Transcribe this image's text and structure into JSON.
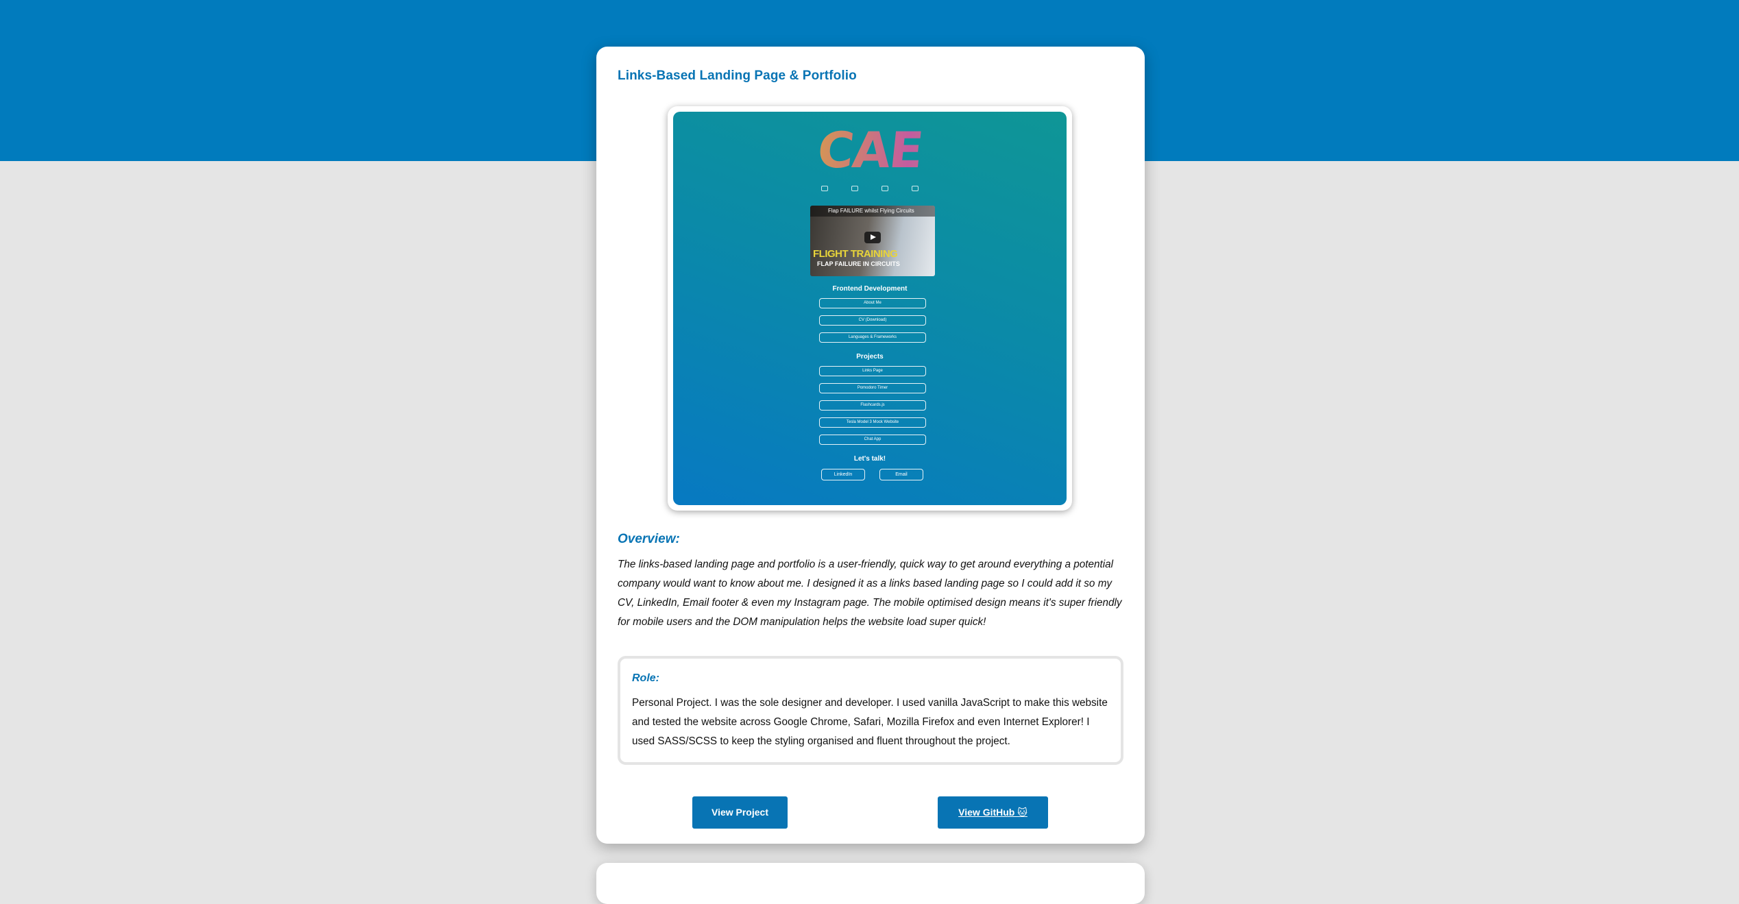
{
  "project": {
    "title": "Links-Based Landing Page & Portfolio",
    "overview_heading": "Overview:",
    "overview_text": "The links-based landing page and portfolio is a user-friendly, quick way to get around everything a potential company would want to know about me. I designed it as a links based landing page so I could add it so my CV, LinkedIn, Email footer & even my Instagram page. The mobile optimised design means it's super friendly for mobile users and the DOM manipulation helps the website load super quick!",
    "role_heading": "Role:",
    "role_text": "Personal Project. I was the sole designer and developer. I used vanilla JavaScript to make this website and tested the website across Google Chrome, Safari, Mozilla Firefox and even Internet Explorer! I used SASS/SCSS to keep the styling organised and fluent throughout the project.",
    "view_project_label": "View Project",
    "view_github_label": "View GitHub 🐱"
  },
  "mockup": {
    "logo": "CAE",
    "social_icons": [
      "instagram-icon",
      "email-icon",
      "github-icon",
      "linkedin-icon"
    ],
    "video": {
      "bar_title": "Flap FAILURE whilst Flying Circuits",
      "thumb_title": "FLIGHT TRAINING",
      "thumb_subtitle": "FLAP FAILURE IN CIRCUITS"
    },
    "section_frontend": "Frontend Development",
    "frontend_links": [
      "About Me",
      "CV (Download)",
      "Languages & Frameworks"
    ],
    "section_projects": "Projects",
    "project_links": [
      "Links Page",
      "Pomodoro Timer",
      "Flashcards.js",
      "Tesla Model 3 Mock Website",
      "Chat App"
    ],
    "section_contact": "Let's talk!",
    "contact_links": [
      "LinkedIn",
      "Email"
    ]
  },
  "colors": {
    "brand_blue": "#017bbd",
    "heading_blue": "#0874b4",
    "page_background": "#e5e5e5"
  }
}
